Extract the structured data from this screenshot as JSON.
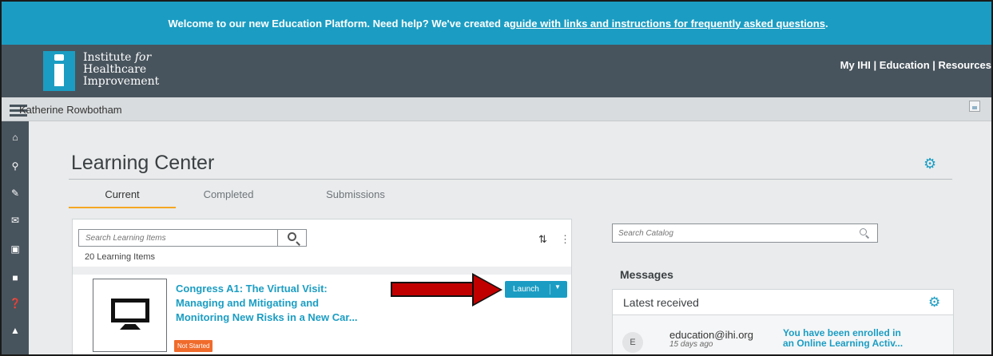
{
  "banner": {
    "text": "Welcome to our new Education Platform. Need help? We've created a ",
    "link": "guide with links and instructions for frequently asked questions",
    "end": "."
  },
  "header": {
    "logo_line1": "Institute",
    "logo_line1_italic": "for",
    "logo_line2": "Healthcare",
    "logo_line3": "Improvement",
    "links": [
      "My IHI",
      "Education",
      "Resources"
    ],
    "separator": " | "
  },
  "userbar": {
    "username": "Katherine Rowbotham"
  },
  "leftnav": {
    "icons": [
      "home-icon",
      "search-icon",
      "edit-icon",
      "mail-icon",
      "briefcase-icon",
      "document-icon",
      "help-icon",
      "bell-icon"
    ]
  },
  "page": {
    "title": "Learning Center"
  },
  "tabs": [
    {
      "label": "Current",
      "active": true
    },
    {
      "label": "Completed",
      "active": false
    },
    {
      "label": "Submissions",
      "active": false
    }
  ],
  "learning": {
    "search_placeholder": "Search Learning Items",
    "count": "20 Learning Items",
    "item": {
      "title": "Congress A1: The Virtual Visit: Managing and Mitigating and Monitoring New Risks in a New Car...",
      "status": "Not Started",
      "launch_label": "Launch"
    }
  },
  "catalog": {
    "search_placeholder": "Search Catalog"
  },
  "messages": {
    "title": "Messages",
    "latest_label": "Latest received",
    "items": [
      {
        "avatar": "E",
        "sender": "education@ihi.org",
        "time": "15 days ago",
        "subject": "You have been enrolled in an Online Learning Activ..."
      }
    ]
  },
  "colors": {
    "accent": "#1b9dc3",
    "header_bg": "#48545d",
    "status_badge": "#f06b2b",
    "arrow": "#c00000"
  }
}
